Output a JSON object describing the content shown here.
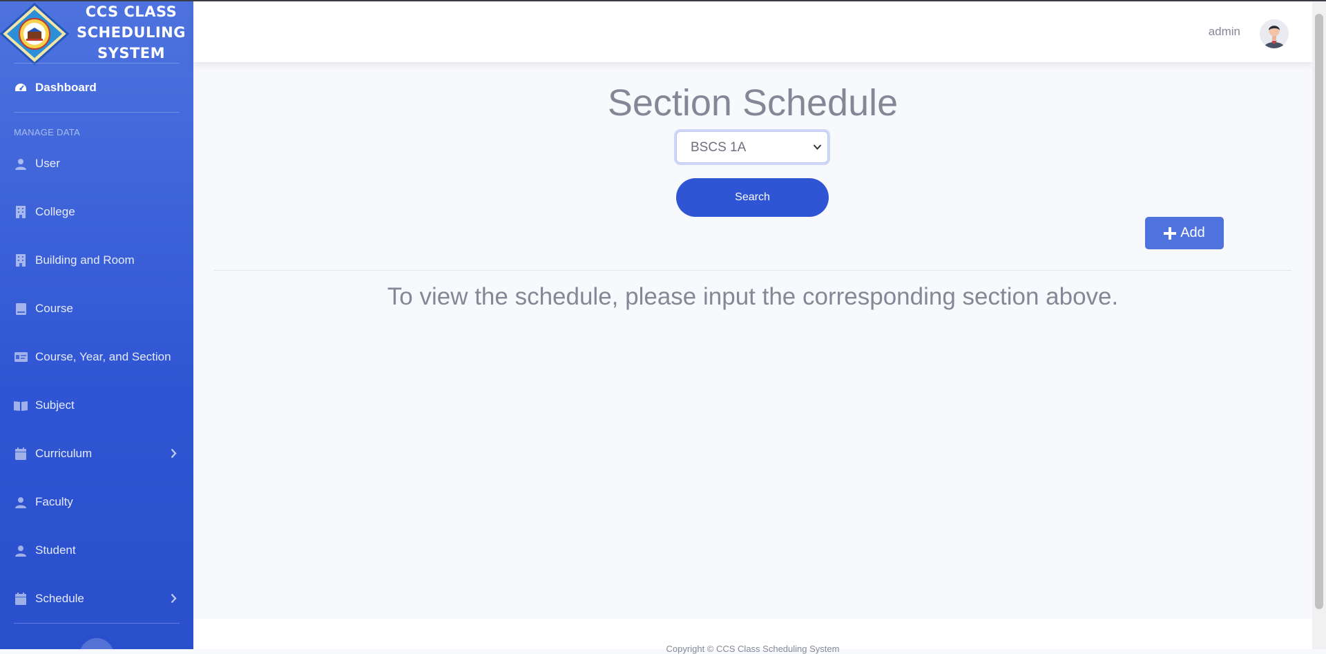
{
  "brand": {
    "line1": "CCS CLASS",
    "line2": "SCHEDULING",
    "line3": "SYSTEM",
    "logo_icon": "school-seal-logo"
  },
  "sidebar": {
    "dashboard": {
      "label": "Dashboard",
      "icon": "tachometer-icon"
    },
    "heading": "MANAGE DATA",
    "items": [
      {
        "label": "User",
        "icon": "user-icon"
      },
      {
        "label": "College",
        "icon": "building-icon"
      },
      {
        "label": "Building and Room",
        "icon": "building-icon"
      },
      {
        "label": "Course",
        "icon": "book-icon"
      },
      {
        "label": "Course, Year, and Section",
        "icon": "id-card-icon"
      },
      {
        "label": "Subject",
        "icon": "open-book-icon"
      },
      {
        "label": "Curriculum",
        "icon": "calendar-icon",
        "has_submenu": true
      },
      {
        "label": "Faculty",
        "icon": "user-icon"
      },
      {
        "label": "Student",
        "icon": "user-icon"
      },
      {
        "label": "Schedule",
        "icon": "calendar-icon",
        "has_submenu": true
      }
    ]
  },
  "topbar": {
    "username": "admin",
    "avatar_icon": "user-avatar"
  },
  "main": {
    "title": "Section Schedule",
    "section_select": {
      "selected": "BSCS 1A"
    },
    "search_label": "Search",
    "add_label": "Add",
    "message": "To view the schedule, please input the corresponding section above."
  },
  "footer": {
    "text": "Copyright © CCS Class Scheduling System"
  },
  "colors": {
    "sidebar_primary": "#4e73df",
    "sidebar_dark": "#2f55d4",
    "button_primary": "#2f55d4",
    "add_button": "#4e73df",
    "text_muted": "#858796",
    "page_bg": "#f8f9fc"
  }
}
